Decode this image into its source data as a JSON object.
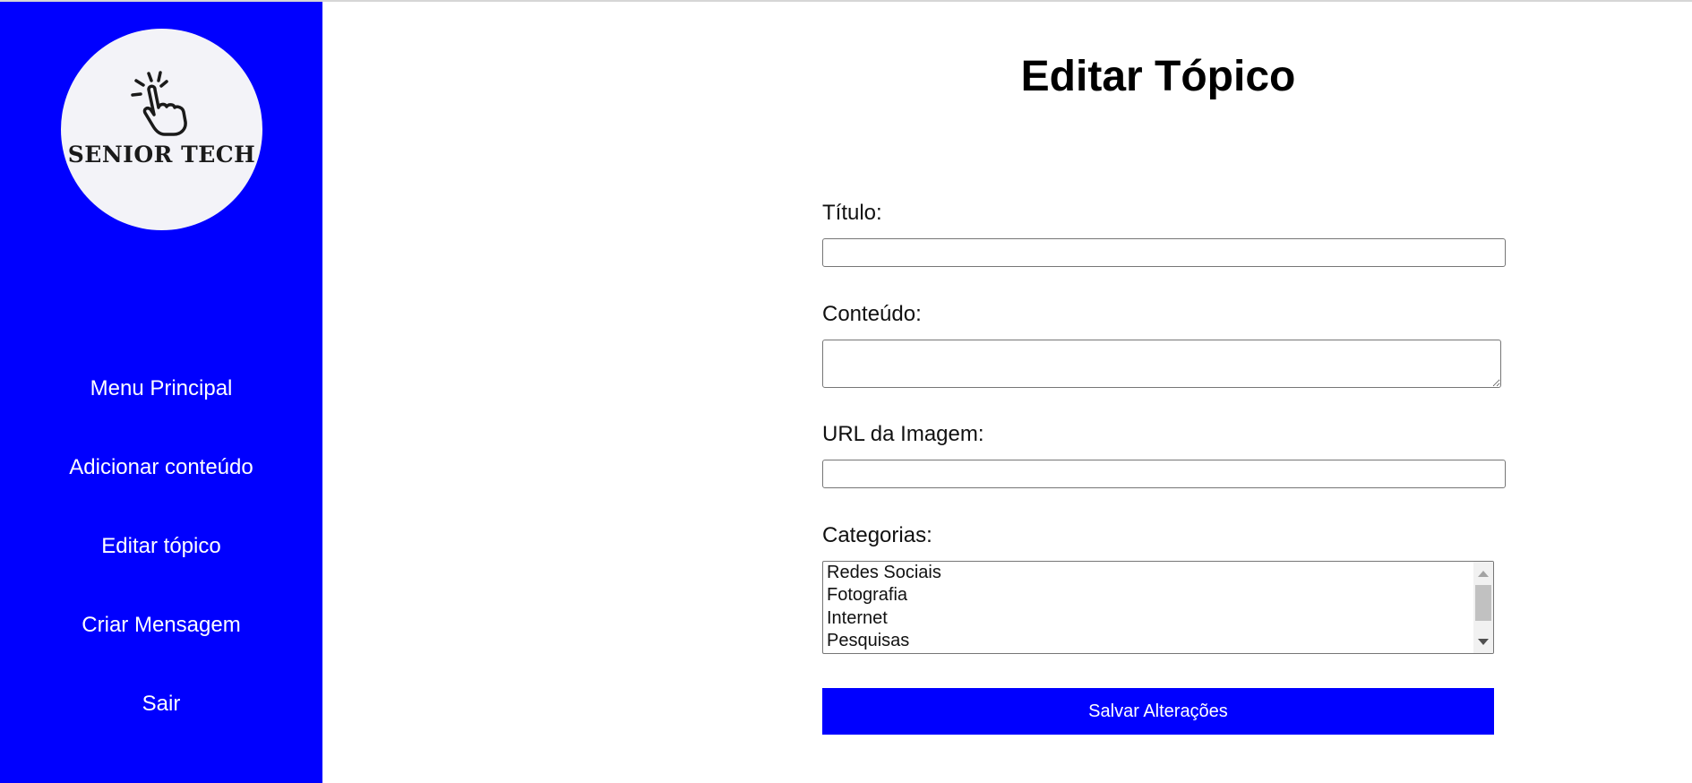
{
  "brand": {
    "logo_text": "SENIOR TECH"
  },
  "sidebar": {
    "items": [
      {
        "label": "Menu Principal"
      },
      {
        "label": "Adicionar conteúdo"
      },
      {
        "label": "Editar tópico"
      },
      {
        "label": "Criar Mensagem"
      },
      {
        "label": "Sair"
      }
    ]
  },
  "main": {
    "title": "Editar Tópico",
    "form": {
      "titulo_label": "Título:",
      "titulo_value": "",
      "conteudo_label": "Conteúdo:",
      "conteudo_value": "",
      "url_label": "URL da Imagem:",
      "url_value": "",
      "categorias_label": "Categorias:",
      "categorias_options": [
        "Redes Sociais",
        "Fotografia",
        "Internet",
        "Pesquisas"
      ],
      "save_label": "Salvar Alterações"
    }
  },
  "colors": {
    "sidebar_bg": "#0000ff",
    "button_bg": "#0000ff",
    "logo_bg": "#f3f3f8"
  },
  "icons": {
    "logo_icon": "pointing-hand-icon",
    "scroll_up": "triangle-up-icon",
    "scroll_down": "triangle-down-icon"
  }
}
